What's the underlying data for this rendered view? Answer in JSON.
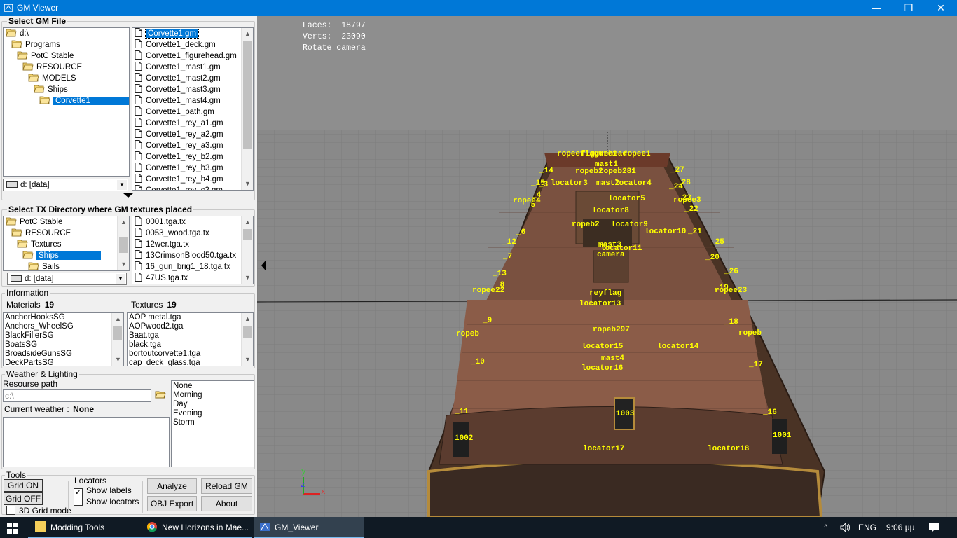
{
  "window": {
    "title": "GM Viewer",
    "minimize": "—",
    "maximize": "❐",
    "close": "✕"
  },
  "gm_file": {
    "title": "Select GM File",
    "tree": [
      {
        "label": "d:\\",
        "indent": 0,
        "selected": false
      },
      {
        "label": "Programs",
        "indent": 1,
        "selected": false
      },
      {
        "label": "PotC Stable",
        "indent": 2,
        "selected": false
      },
      {
        "label": "RESOURCE",
        "indent": 3,
        "selected": false
      },
      {
        "label": "MODELS",
        "indent": 4,
        "selected": false
      },
      {
        "label": "Ships",
        "indent": 5,
        "selected": false
      },
      {
        "label": "Corvette1",
        "indent": 6,
        "selected": true
      }
    ],
    "drive": "d: [data]",
    "files": [
      "Corvette1.gm",
      "Corvette1_deck.gm",
      "Corvette1_figurehead.gm",
      "Corvette1_mast1.gm",
      "Corvette1_mast2.gm",
      "Corvette1_mast3.gm",
      "Corvette1_mast4.gm",
      "Corvette1_path.gm",
      "Corvette1_rey_a1.gm",
      "Corvette1_rey_a2.gm",
      "Corvette1_rey_a3.gm",
      "Corvette1_rey_b2.gm",
      "Corvette1_rey_b3.gm",
      "Corvette1_rey_b4.gm",
      "Corvette1_rey_c2.gm"
    ],
    "selected_file": "Corvette1.gm"
  },
  "tx_dir": {
    "title": "Select TX Directory where GM textures placed",
    "tree": [
      {
        "label": "PotC Stable",
        "indent": 0,
        "selected": false
      },
      {
        "label": "RESOURCE",
        "indent": 1,
        "selected": false
      },
      {
        "label": "Textures",
        "indent": 2,
        "selected": false
      },
      {
        "label": "Ships",
        "indent": 3,
        "selected": true
      },
      {
        "label": "Sails",
        "indent": 4,
        "selected": false
      }
    ],
    "drive": "d: [data]",
    "files": [
      "0001.tga.tx",
      "0053_wood.tga.tx",
      "12wer.tga.tx",
      "13CrimsonBlood50.tga.tx",
      "16_gun_brig1_18.tga.tx",
      "47US.tga.tx"
    ]
  },
  "information": {
    "title": "Information",
    "materials_label": "Materials",
    "materials_count": "19",
    "textures_label": "Textures",
    "textures_count": "19",
    "materials": [
      "AnchorHooksSG",
      "Anchors_WheelSG",
      "BlackFillerSG",
      "BoatsSG",
      "BroadsideGunsSG",
      "DeckPartsSG"
    ],
    "textures": [
      "AOP metal.tga",
      "AOPwood2.tga",
      "Baat.tga",
      "black.tga",
      "bortoutcorvette1.tga",
      "cap_deck_glass.tga"
    ]
  },
  "weather": {
    "title": "Weather & Lighting",
    "resource_path_label": "Resourse path",
    "resource_path_value": "c:\\",
    "current_weather_label": "Current weather :",
    "current_weather_value": "None",
    "options": [
      "None",
      "Morning",
      "Day",
      "Evening",
      "Storm"
    ]
  },
  "tools": {
    "title": "Tools",
    "grid_on": "Grid ON",
    "grid_off": "Grid OFF",
    "grid_3d": "3D Grid mode",
    "locators_title": "Locators",
    "show_labels": "Show labels",
    "show_labels_checked": true,
    "show_locators": "Show locators",
    "show_locators_checked": false,
    "analyze": "Analyze",
    "reload": "Reload GM",
    "obj_export": "OBJ Export",
    "about": "About"
  },
  "viewport": {
    "faces_label": "Faces:",
    "faces": "18797",
    "verts_label": "Verts:",
    "verts": "23090",
    "mode": "Rotate camera",
    "axis_y": "y",
    "axis_z": "z",
    "axis_x": "x",
    "locators": [
      "ropeeflagure1",
      "figurehead",
      "ropee1",
      "mast1",
      "ropeb2",
      "ropeb281",
      "locator3",
      "mast2",
      "locator4",
      "locator5",
      "ropee4",
      "ropee3",
      "locator8",
      "ropeb2",
      "locator9",
      "locator10",
      "_21",
      "mast3",
      "locator11",
      "camera",
      "ropee22",
      "ropee23",
      "reyflag",
      "locator13",
      "ropeb297",
      "ropeb",
      "ropeb",
      "locator15",
      "locator14",
      "mast4",
      "locator16",
      "1003",
      "1002",
      "1001",
      "locator17",
      "locator18",
      "_14",
      "_27",
      "_15",
      "_28",
      "_3",
      "_24",
      "_4",
      "_23",
      "_5",
      "_22",
      "_6",
      "_12",
      "_25",
      "_7",
      "_20",
      "_13",
      "_26",
      "_8",
      "_19",
      "_9",
      "_18",
      "_10",
      "_17",
      "_11",
      "_16"
    ]
  },
  "taskbar": {
    "items": [
      "Modding Tools",
      "New Horizons in Mae...",
      "GM_Viewer"
    ],
    "lang": "ENG",
    "time": "9:06 μμ"
  }
}
